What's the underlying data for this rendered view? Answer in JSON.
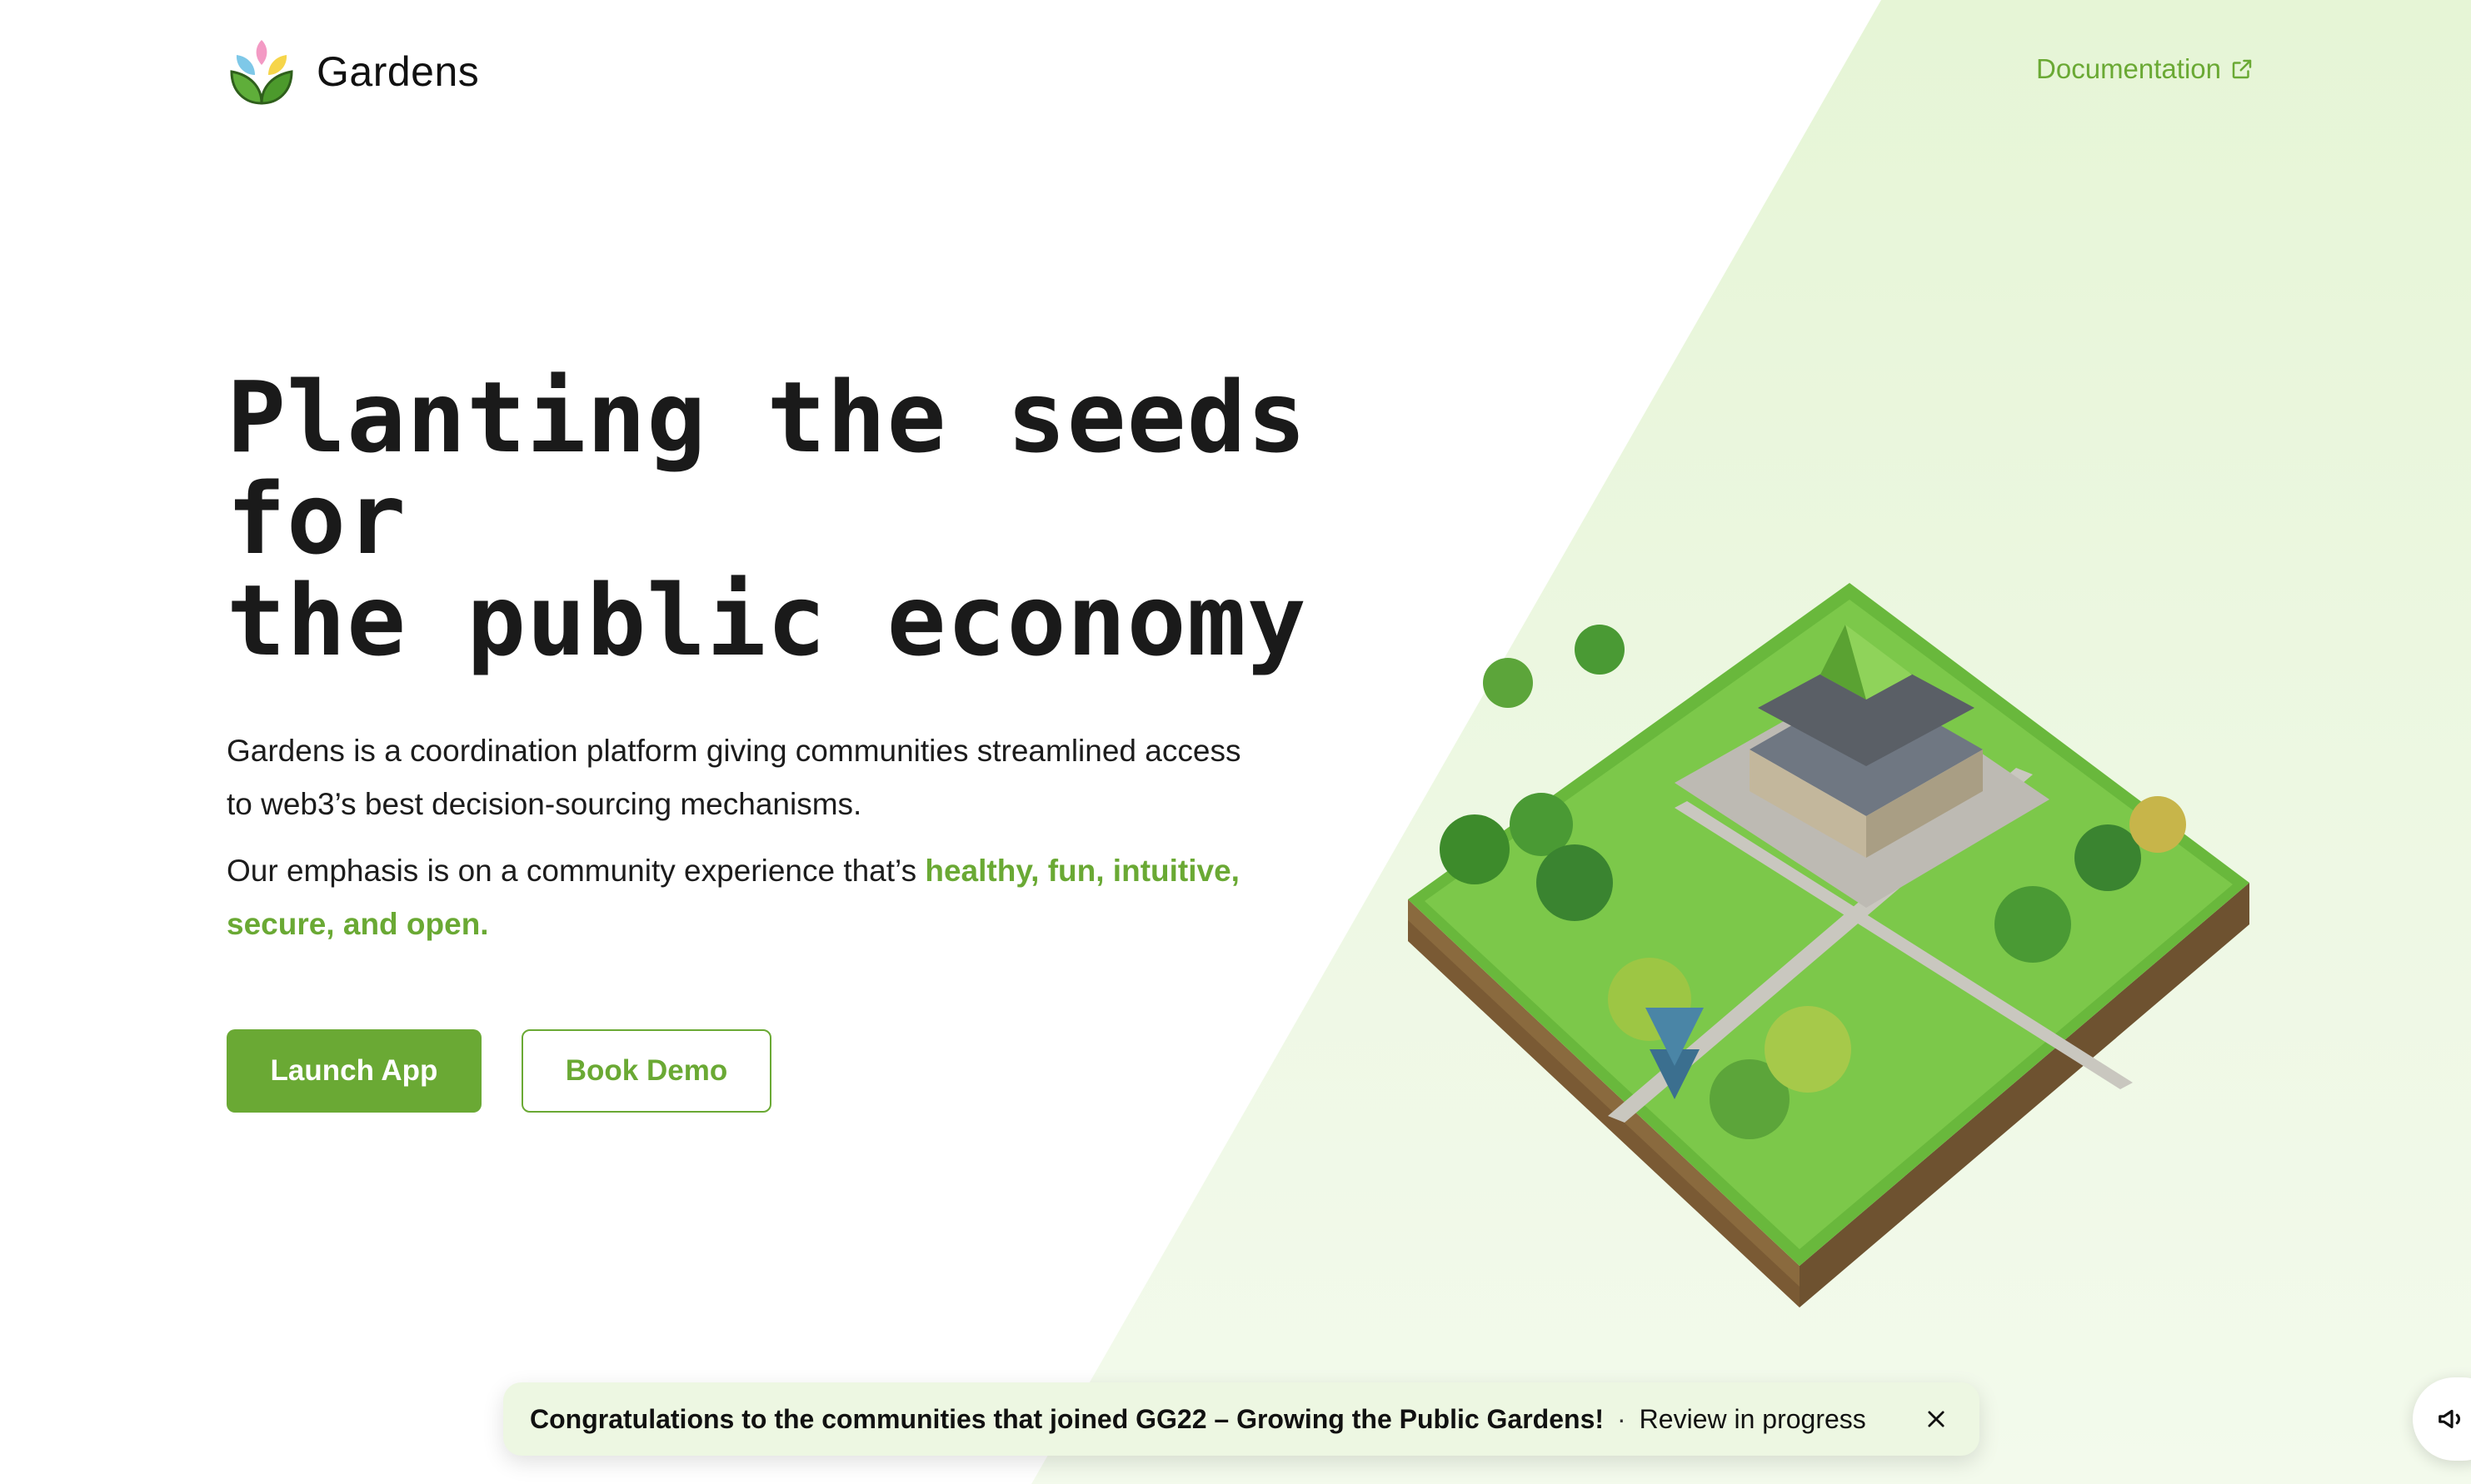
{
  "header": {
    "brand_name": "Gardens",
    "doc_link": "Documentation"
  },
  "hero": {
    "title_line1": "Planting the seeds for",
    "title_line2": "the public economy",
    "desc1": "Gardens is a coordination platform giving communities streamlined access to web3’s best decision-sourcing mechanisms.",
    "desc2_prefix": "Our emphasis is on a community experience that’s ",
    "desc2_highlight": "healthy, fun, intuitive, secure, and open.",
    "launch_label": "Launch App",
    "demo_label": "Book Demo"
  },
  "announcement": {
    "message": "Congratulations to the communities that joined GG22 – Growing the Public Gardens!",
    "separator": "·",
    "status": "Review in progress"
  },
  "colors": {
    "accent": "#6aa934",
    "background_tint": "#e6f5d6",
    "text": "#1c1c1c"
  },
  "icons": [
    "gardens-logo-icon",
    "external-link-icon",
    "close-icon",
    "megaphone-icon"
  ]
}
